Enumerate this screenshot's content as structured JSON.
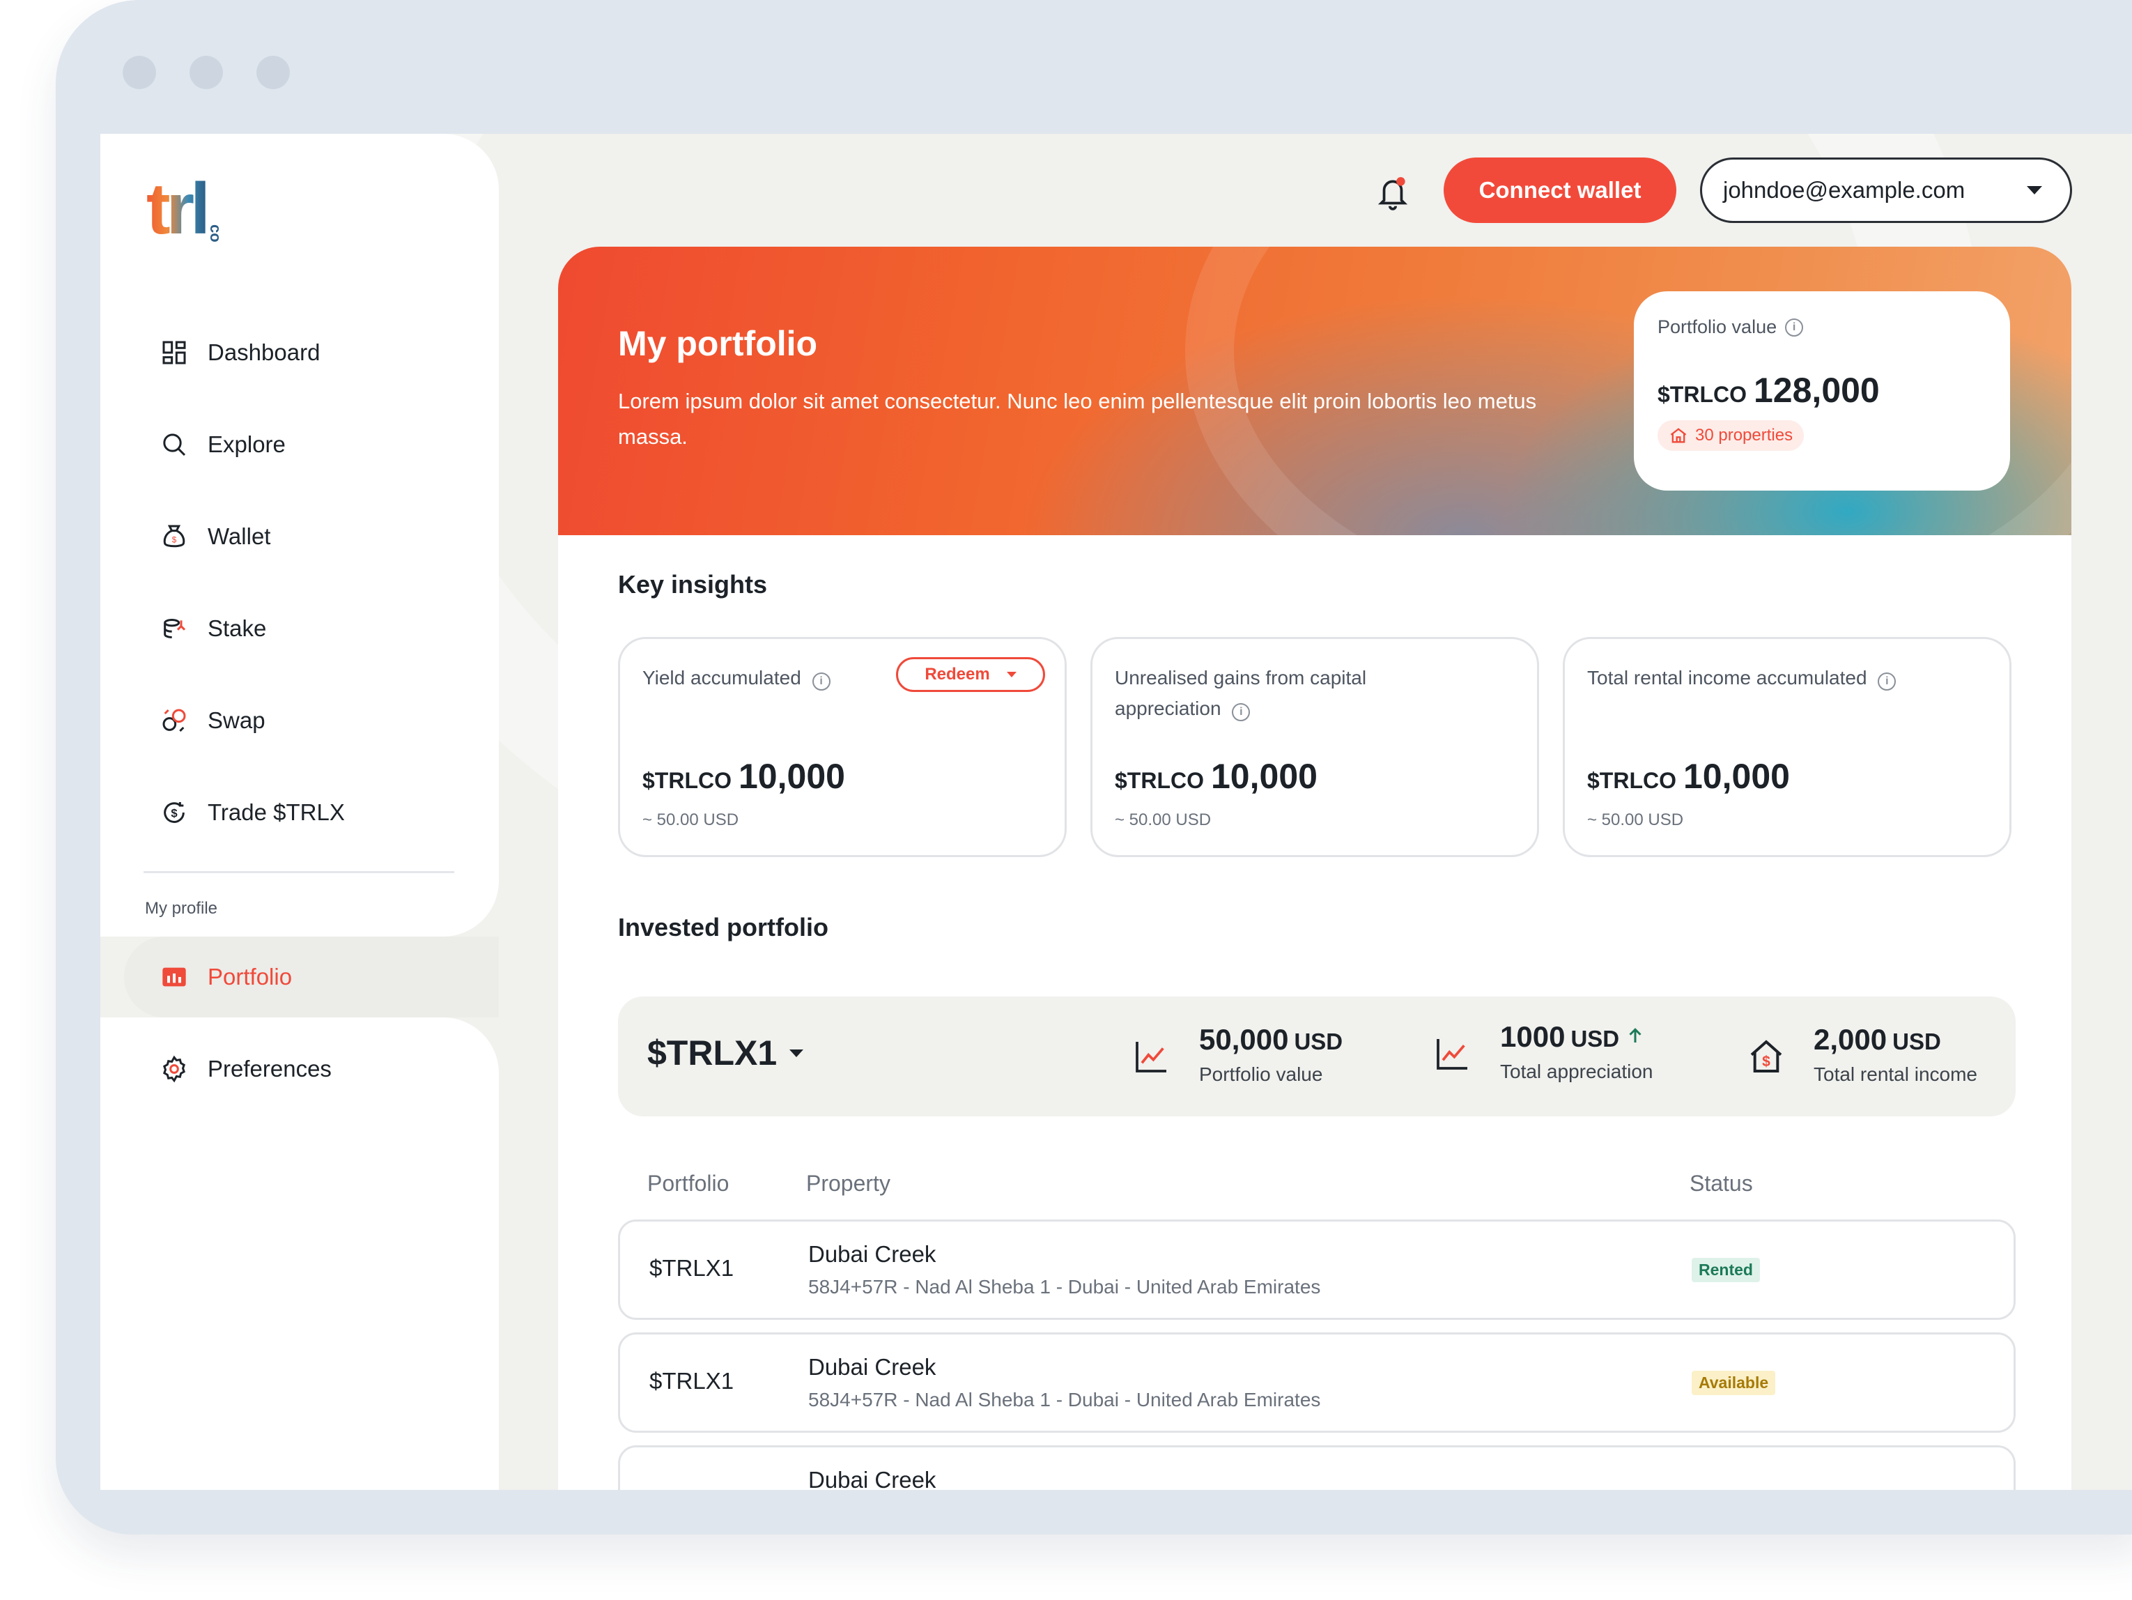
{
  "logo": {
    "text": "trl",
    "suffix": "co"
  },
  "sidebar": {
    "items": [
      {
        "label": "Dashboard",
        "icon": "grid-icon"
      },
      {
        "label": "Explore",
        "icon": "search-icon"
      },
      {
        "label": "Wallet",
        "icon": "money-bag-icon"
      },
      {
        "label": "Stake",
        "icon": "stake-coins-icon"
      },
      {
        "label": "Swap",
        "icon": "swap-icon"
      },
      {
        "label": "Trade $TRLX",
        "icon": "trade-icon"
      }
    ],
    "profile_header": "My profile",
    "profile_items": [
      {
        "label": "Portfolio",
        "icon": "bar-chart-icon",
        "active": true
      },
      {
        "label": "Preferences",
        "icon": "gear-icon",
        "active": false
      }
    ]
  },
  "topbar": {
    "connect_label": "Connect wallet",
    "account_email": "johndoe@example.com"
  },
  "hero": {
    "title": "My portfolio",
    "description": "Lorem ipsum dolor sit amet consectetur. Nunc leo enim pellentesque elit proin lobortis leo metus massa.",
    "portfolio_value_label": "Portfolio value",
    "currency": "$TRLCO",
    "portfolio_value": "128,000",
    "properties_badge": "30 properties"
  },
  "insights": {
    "title": "Key insights",
    "redeem_label": "Redeem",
    "cards": [
      {
        "label": "Yield accumulated",
        "currency": "$TRLCO",
        "value": "10,000",
        "sub": "~ 50.00 USD"
      },
      {
        "label": "Unrealised gains from capital appreciation",
        "currency": "$TRLCO",
        "value": "10,000",
        "sub": "~ 50.00 USD"
      },
      {
        "label": "Total rental income accumulated",
        "currency": "$TRLCO",
        "value": "10,000",
        "sub": "~ 50.00 USD"
      }
    ]
  },
  "invested": {
    "title": "Invested portfolio",
    "token": "$TRLX1",
    "stats": [
      {
        "value": "50,000",
        "unit": "USD",
        "label": "Portfolio value",
        "icon": "line-chart-icon"
      },
      {
        "value": "1000",
        "unit": "USD",
        "label": "Total appreciation",
        "icon": "line-chart-icon",
        "trend": "up"
      },
      {
        "value": "2,000",
        "unit": "USD",
        "label": "Total rental income",
        "icon": "house-dollar-icon"
      }
    ],
    "columns": [
      "Portfolio",
      "Property",
      "Status"
    ],
    "rows": [
      {
        "portfolio": "$TRLX1",
        "property": "Dubai Creek",
        "address": "58J4+57R - Nad Al Sheba 1 - Dubai - United Arab Emirates",
        "status": "Rented"
      },
      {
        "portfolio": "$TRLX1",
        "property": "Dubai Creek",
        "address": "58J4+57R - Nad Al Sheba 1 - Dubai - United Arab Emirates",
        "status": "Available"
      },
      {
        "portfolio": "",
        "property": "Dubai Creek",
        "address": "",
        "status": ""
      }
    ]
  },
  "colors": {
    "accent": "#f24a3a",
    "rented": "#1c7a58",
    "available": "#a67a06"
  }
}
